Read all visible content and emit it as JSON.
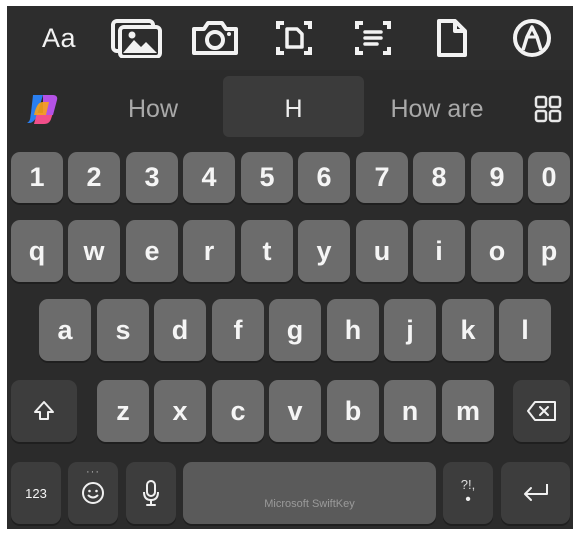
{
  "toolbar": {
    "font_label": "Aa",
    "icons": [
      "gallery-icon",
      "camera-icon",
      "clipboard-icon",
      "text-scan-icon",
      "document-icon",
      "pen-icon"
    ]
  },
  "suggestions": {
    "left": "How",
    "center": "H",
    "right": "How are"
  },
  "rows": {
    "numbers": [
      "1",
      "2",
      "3",
      "4",
      "5",
      "6",
      "7",
      "8",
      "9",
      "0"
    ],
    "row1": [
      "q",
      "w",
      "e",
      "r",
      "t",
      "y",
      "u",
      "i",
      "o",
      "p"
    ],
    "row2": [
      "a",
      "s",
      "d",
      "f",
      "g",
      "h",
      "j",
      "k",
      "l"
    ],
    "row3": [
      "z",
      "x",
      "c",
      "v",
      "b",
      "n",
      "m"
    ]
  },
  "bottom": {
    "numbers_label": "123",
    "space_label": "Microsoft SwiftKey",
    "punct_label": "?!,",
    "punct_dot": "•",
    "emoji_dots": "···"
  },
  "colors": {
    "keyboard_bg": "#2b2b2b",
    "key_bg": "#6c6c6c",
    "function_key_bg": "#3d3d3d",
    "key_text": "#f5f5f5"
  }
}
